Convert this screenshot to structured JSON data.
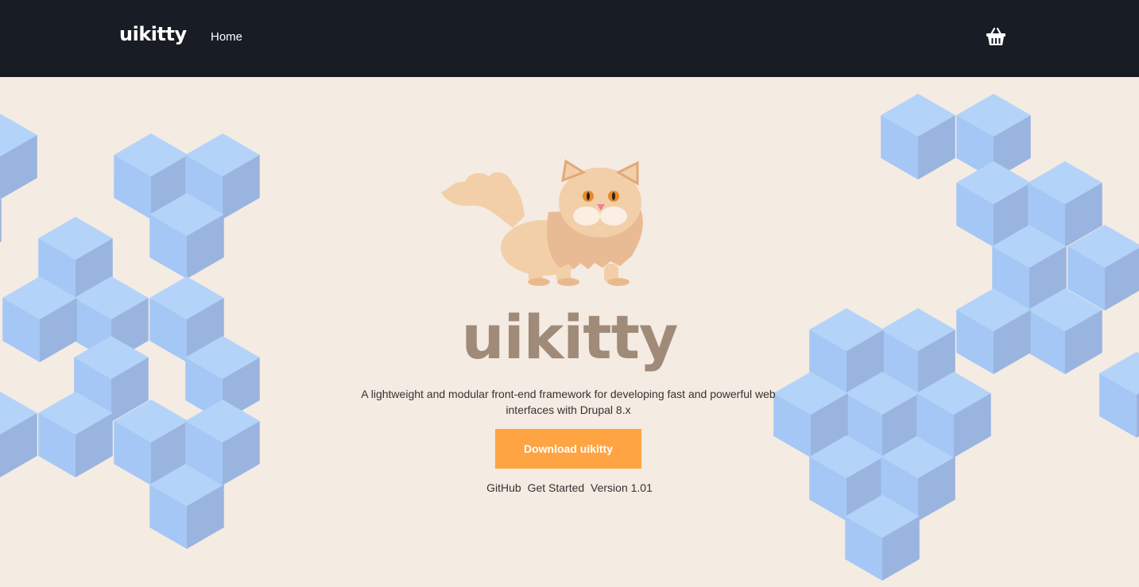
{
  "navbar": {
    "brand": "uikitty",
    "home_label": "Home",
    "cart_icon": "basket-icon"
  },
  "hero": {
    "illustration": "cat-illustration",
    "title": "uikitty",
    "tagline": "A lightweight and modular front-end framework for developing fast and powerful web interfaces with Drupal 8.x",
    "download_label": "Download uikitty",
    "links": {
      "github": "GitHub",
      "get_started": "Get Started",
      "version": "Version 1.01"
    }
  },
  "colors": {
    "navbar_bg": "#181c24",
    "hero_bg": "#f4ebe2",
    "accent": "#fea443",
    "title": "#a08a78",
    "cube_light": "#b3d3f9",
    "cube_mid": "#a5c7f5",
    "cube_dark": "#9ab4e0"
  }
}
